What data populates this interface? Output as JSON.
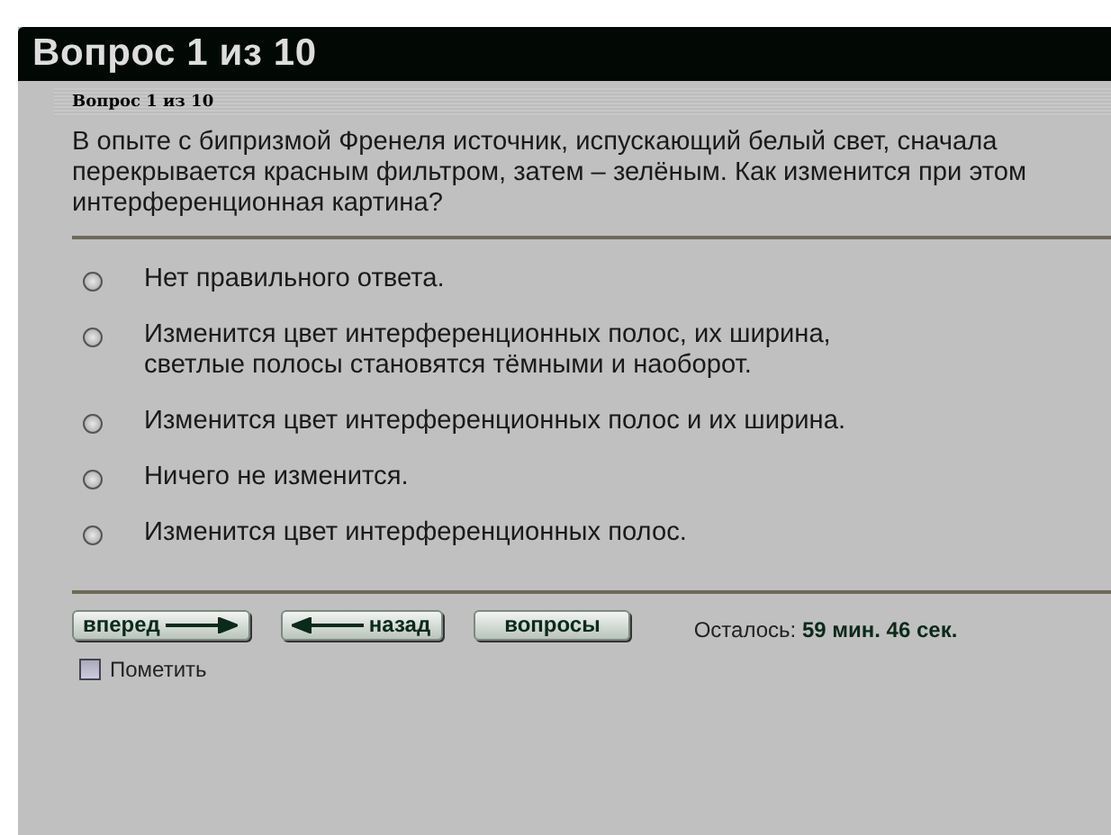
{
  "header": {
    "title": "Вопрос 1 из 10"
  },
  "subheader": "Вопрос 1 из 10",
  "question": "В опыте с бипризмой Френеля источник, испускающий белый свет, сначала перекрывается красным фильтром, затем – зелёным. Как изменится при этом интерференционная картина?",
  "options": [
    {
      "label": "Нет правильного ответа.",
      "selected": false
    },
    {
      "label": "Изменится цвет интерференционных полос, их ширина, светлые полосы становятся тёмными и наоборот.",
      "selected": false
    },
    {
      "label": "Изменится цвет интерференционных полос и их ширина.",
      "selected": false
    },
    {
      "label": "Ничего не изменится.",
      "selected": false
    },
    {
      "label": "Изменится цвет интерференционных полос.",
      "selected": false
    }
  ],
  "buttons": [
    {
      "label": "вперед",
      "kind": "next"
    },
    {
      "label": "назад",
      "kind": "back"
    },
    {
      "label": "вопросы",
      "kind": "plain"
    }
  ],
  "timer": "Осталось: **59 мин. 46 сек.**",
  "mark": {
    "label": "Пометить",
    "checked": false
  }
}
